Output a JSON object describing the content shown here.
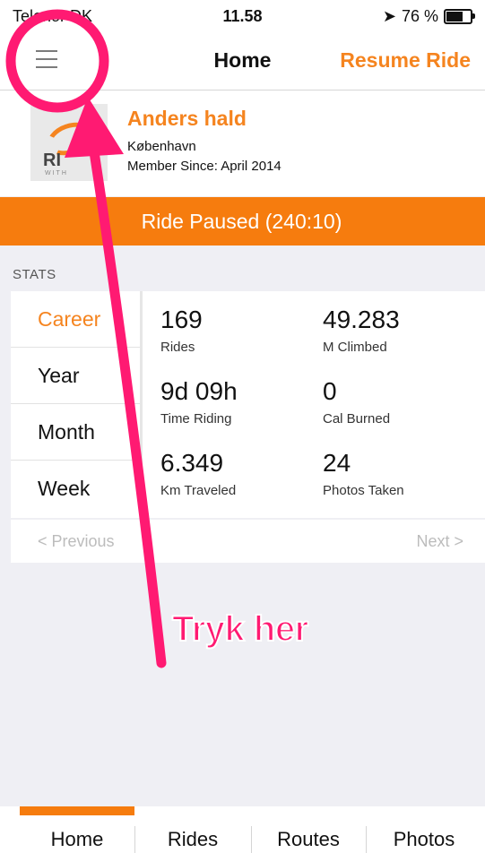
{
  "status_bar": {
    "carrier": "Telenor DK",
    "time": "11.58",
    "battery": "76 %",
    "battery_level": 0.76
  },
  "nav": {
    "title": "Home",
    "resume_label": "Resume Ride",
    "menu_icon": "hamburger-menu-icon"
  },
  "profile": {
    "name": "Anders hald",
    "city": "København",
    "member_since": "Member Since: April 2014"
  },
  "banner": {
    "text": "Ride Paused (240:10)"
  },
  "stats": {
    "header": "STATS",
    "tabs": [
      "Career",
      "Year",
      "Month",
      "Week"
    ],
    "active_tab": "Career",
    "items": [
      {
        "value": "169",
        "label": "Rides"
      },
      {
        "value": "49.283",
        "label": "M Climbed"
      },
      {
        "value": "9d 09h",
        "label": "Time Riding"
      },
      {
        "value": "0",
        "label": "Cal Burned"
      },
      {
        "value": "6.349",
        "label": "Km Traveled"
      },
      {
        "value": "24",
        "label": "Photos Taken"
      }
    ]
  },
  "pager": {
    "previous": "<  Previous",
    "next": "Next  >"
  },
  "tab_bar": {
    "tabs": [
      "Home",
      "Rides",
      "Routes",
      "Photos"
    ],
    "active": "Home"
  },
  "annotation": {
    "text": "Tryk her",
    "color": "#ff1a72"
  },
  "colors": {
    "accent": "#f5841f",
    "banner": "#f67c0e"
  }
}
